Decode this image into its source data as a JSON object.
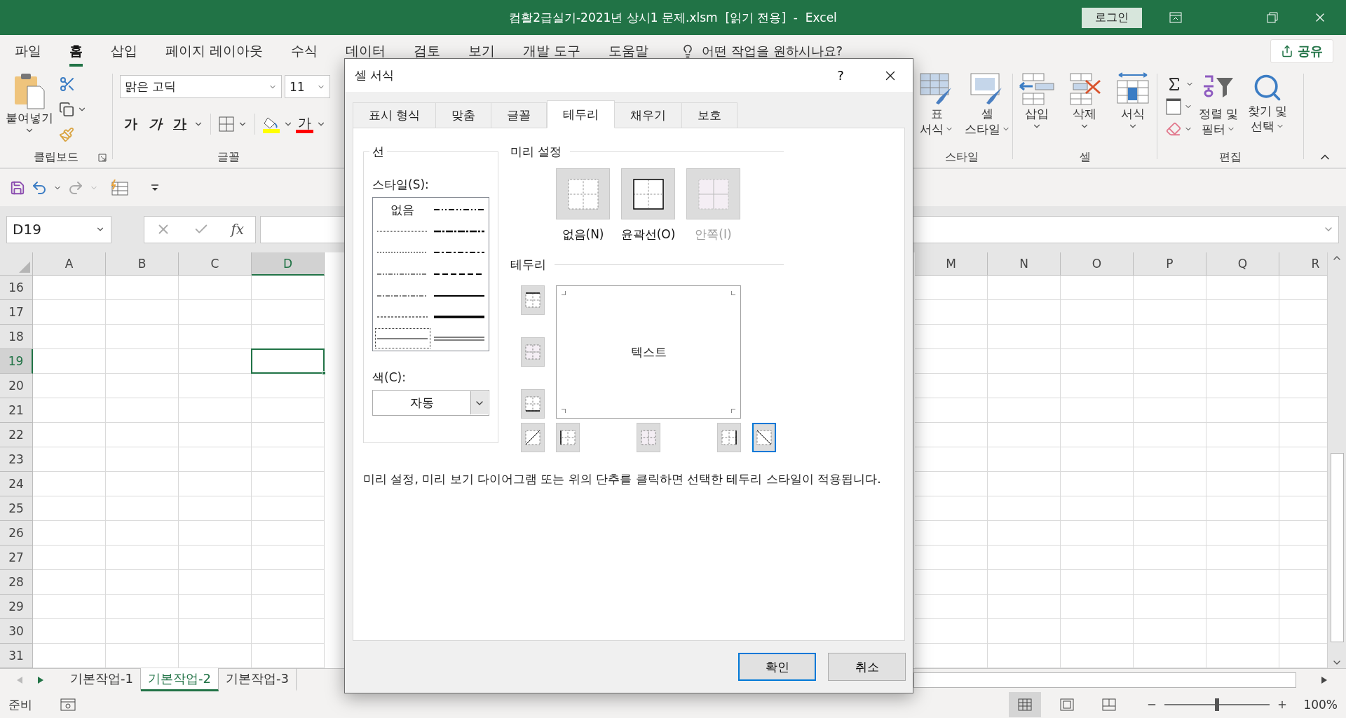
{
  "title_bar": {
    "title": "컴활2급실기-2021년 상시1 문제.xlsm  [읽기 전용]  -  Excel",
    "login": "로그인"
  },
  "menu_tabs": [
    {
      "label": "파일",
      "selected": false
    },
    {
      "label": "홈",
      "selected": true
    },
    {
      "label": "삽입",
      "selected": false
    },
    {
      "label": "페이지 레이아웃",
      "selected": false
    },
    {
      "label": "수식",
      "selected": false
    },
    {
      "label": "데이터",
      "selected": false
    },
    {
      "label": "검토",
      "selected": false
    },
    {
      "label": "보기",
      "selected": false
    },
    {
      "label": "개발 도구",
      "selected": false
    },
    {
      "label": "도움말",
      "selected": false
    }
  ],
  "tell_me": {
    "placeholder": "어떤 작업을 원하시나요?"
  },
  "share": "공유",
  "ribbon": {
    "clipboard": {
      "paste": "붙여넣기",
      "label": "클립보드"
    },
    "font": {
      "font_name": "맑은 고딕",
      "font_size": "11",
      "bold": "가",
      "italic": "가",
      "underline": "가",
      "font_color": "가",
      "label": "글꼴"
    },
    "styles": {
      "table_format": [
        "표",
        "서식"
      ],
      "cell_styles": [
        "셀",
        "스타일"
      ],
      "label": "스타일"
    },
    "cells": {
      "buttons": [
        {
          "kind": "insert",
          "label": "삽입"
        },
        {
          "kind": "delete",
          "label": "삭제"
        },
        {
          "kind": "format",
          "label": "서식"
        }
      ],
      "label": "셀"
    },
    "editing": {
      "sort_filter": [
        "정렬 및",
        "필터"
      ],
      "find_select": [
        "찾기 및",
        "선택"
      ],
      "label": "편집"
    }
  },
  "formula_bar": {
    "name_box": "D19",
    "function_label": "fx"
  },
  "sheet": {
    "columns": [
      {
        "label": "A",
        "selected": false
      },
      {
        "label": "B",
        "selected": false
      },
      {
        "label": "C",
        "selected": false
      },
      {
        "label": "D",
        "selected": true
      }
    ],
    "columns_right": [
      {
        "label": "M",
        "selected": false
      },
      {
        "label": "N",
        "selected": false
      },
      {
        "label": "O",
        "selected": false
      },
      {
        "label": "P",
        "selected": false
      },
      {
        "label": "Q",
        "selected": false
      },
      {
        "label": "R",
        "selected": false
      }
    ],
    "rows": [
      {
        "label": "16",
        "selected": false
      },
      {
        "label": "17",
        "selected": false
      },
      {
        "label": "18",
        "selected": false
      },
      {
        "label": "19",
        "selected": true
      },
      {
        "label": "20",
        "selected": false
      },
      {
        "label": "21",
        "selected": false
      },
      {
        "label": "22",
        "selected": false
      },
      {
        "label": "23",
        "selected": false
      },
      {
        "label": "24",
        "selected": false
      },
      {
        "label": "25",
        "selected": false
      },
      {
        "label": "26",
        "selected": false
      },
      {
        "label": "27",
        "selected": false
      },
      {
        "label": "28",
        "selected": false
      },
      {
        "label": "29",
        "selected": false
      },
      {
        "label": "30",
        "selected": false
      },
      {
        "label": "31",
        "selected": false
      }
    ]
  },
  "sheet_tabs": [
    {
      "label": "기본작업-1",
      "selected": false
    },
    {
      "label": "기본작업-2",
      "selected": true
    },
    {
      "label": "기본작업-3",
      "selected": false
    }
  ],
  "status_bar": {
    "status": "준비",
    "views": [
      {
        "kind": "normal",
        "selected": true
      },
      {
        "kind": "page-layout",
        "selected": false
      },
      {
        "kind": "page-break",
        "selected": false
      }
    ],
    "zoom": {
      "level": 0.5
    },
    "zoom_label": "100%"
  },
  "dialog": {
    "title": "셀 서식",
    "help": "?",
    "tabs": [
      {
        "label": "표시 형식",
        "selected": false
      },
      {
        "label": "맞춤",
        "selected": false
      },
      {
        "label": "글꼴",
        "selected": false
      },
      {
        "label": "테두리",
        "selected": true
      },
      {
        "label": "채우기",
        "selected": false
      },
      {
        "label": "보호",
        "selected": false
      }
    ],
    "line": {
      "legend": "선",
      "style_label": "스타일(S):",
      "styles": [
        {
          "kind": "none",
          "label": "없음",
          "selected": false
        },
        {
          "kind": "hair",
          "selected": false
        },
        {
          "kind": "dotted",
          "selected": false
        },
        {
          "kind": "dash-dot-dot",
          "selected": false
        },
        {
          "kind": "dash-dot",
          "selected": false
        },
        {
          "kind": "dashed",
          "selected": false
        },
        {
          "kind": "thin",
          "selected": true
        },
        {
          "kind": "medium-dash-dot-dot",
          "selected": false
        },
        {
          "kind": "slant-dash-dot",
          "selected": false
        },
        {
          "kind": "medium-dash-dot",
          "selected": false
        },
        {
          "kind": "medium-dashed",
          "selected": false
        },
        {
          "kind": "medium",
          "selected": false
        },
        {
          "kind": "thick",
          "selected": false
        },
        {
          "kind": "double",
          "selected": false
        }
      ],
      "color_label": "색(C):",
      "color_value": "자동"
    },
    "presets": {
      "legend": "미리 설정",
      "buttons": [
        {
          "kind": "none",
          "label": "없음(N)",
          "disabled": false
        },
        {
          "kind": "outline",
          "label": "윤곽선(O)",
          "disabled": false
        },
        {
          "kind": "inside",
          "label": "안쪽(I)",
          "disabled": true
        }
      ]
    },
    "border": {
      "legend": "테두리",
      "preview_text": "텍스트",
      "buttons": [
        {
          "kind": "top",
          "selected": false,
          "disabled": false
        },
        {
          "kind": "middle-horizontal",
          "selected": false,
          "disabled": true
        },
        {
          "kind": "bottom",
          "selected": false,
          "disabled": false
        },
        {
          "kind": "diagonal-up",
          "selected": false,
          "disabled": false
        },
        {
          "kind": "left",
          "selected": false,
          "disabled": false
        },
        {
          "kind": "middle-vertical",
          "selected": false,
          "disabled": true
        },
        {
          "kind": "right",
          "selected": false,
          "disabled": false
        },
        {
          "kind": "diagonal-down",
          "selected": true,
          "disabled": false
        }
      ]
    },
    "description": "미리 설정, 미리 보기 다이어그램 또는 위의 단추를 클릭하면 선택한 테두리 스타일이 적용됩니다.",
    "ok": "확인",
    "cancel": "취소"
  }
}
